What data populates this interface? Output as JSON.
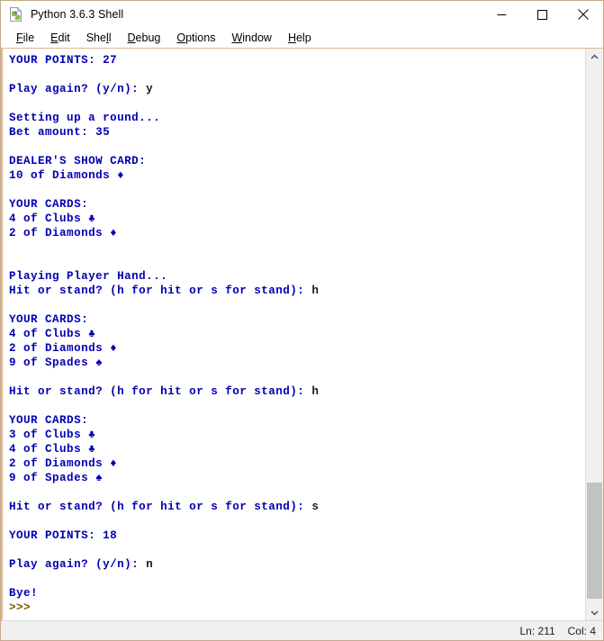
{
  "window": {
    "title": "Python 3.6.3 Shell",
    "icon": "python-file-icon",
    "minimize_label": "Minimize",
    "maximize_label": "Maximize",
    "close_label": "Close"
  },
  "menubar": {
    "items": [
      {
        "label": "File",
        "pre": "",
        "key": "F",
        "post": "ile"
      },
      {
        "label": "Edit",
        "pre": "",
        "key": "E",
        "post": "dit"
      },
      {
        "label": "Shell",
        "pre": "She",
        "key": "l",
        "post": "l"
      },
      {
        "label": "Debug",
        "pre": "",
        "key": "D",
        "post": "ebug"
      },
      {
        "label": "Options",
        "pre": "",
        "key": "O",
        "post": "ptions"
      },
      {
        "label": "Window",
        "pre": "",
        "key": "W",
        "post": "indow"
      },
      {
        "label": "Help",
        "pre": "",
        "key": "H",
        "post": "elp"
      }
    ]
  },
  "colors": {
    "stdout": "#0000b3",
    "stdin": "#1a1a1a",
    "prompt": "#7a5c00",
    "window_border": "#c8a989",
    "background": "#ffffff",
    "chrome": "#f0f0f0"
  },
  "shell": {
    "lines": [
      {
        "segments": [
          {
            "text": "YOUR POINTS: 27",
            "kind": "out"
          }
        ]
      },
      {
        "segments": []
      },
      {
        "segments": [
          {
            "text": "Play again? (y/n): ",
            "kind": "out"
          },
          {
            "text": "y",
            "kind": "in"
          }
        ]
      },
      {
        "segments": []
      },
      {
        "segments": [
          {
            "text": "Setting up a round...",
            "kind": "out"
          }
        ]
      },
      {
        "segments": [
          {
            "text": "Bet amount: 35",
            "kind": "out"
          }
        ]
      },
      {
        "segments": []
      },
      {
        "segments": [
          {
            "text": "DEALER'S SHOW CARD:",
            "kind": "out"
          }
        ]
      },
      {
        "segments": [
          {
            "text": "10 of Diamonds ♦",
            "kind": "out"
          }
        ]
      },
      {
        "segments": []
      },
      {
        "segments": [
          {
            "text": "YOUR CARDS:",
            "kind": "out"
          }
        ]
      },
      {
        "segments": [
          {
            "text": "4 of Clubs ♣",
            "kind": "out"
          }
        ]
      },
      {
        "segments": [
          {
            "text": "2 of Diamonds ♦",
            "kind": "out"
          }
        ]
      },
      {
        "segments": []
      },
      {
        "segments": []
      },
      {
        "segments": [
          {
            "text": "Playing Player Hand...",
            "kind": "out"
          }
        ]
      },
      {
        "segments": [
          {
            "text": "Hit or stand? (h for hit or s for stand): ",
            "kind": "out"
          },
          {
            "text": "h",
            "kind": "in"
          }
        ]
      },
      {
        "segments": []
      },
      {
        "segments": [
          {
            "text": "YOUR CARDS:",
            "kind": "out"
          }
        ]
      },
      {
        "segments": [
          {
            "text": "4 of Clubs ♣",
            "kind": "out"
          }
        ]
      },
      {
        "segments": [
          {
            "text": "2 of Diamonds ♦",
            "kind": "out"
          }
        ]
      },
      {
        "segments": [
          {
            "text": "9 of Spades ♠",
            "kind": "out"
          }
        ]
      },
      {
        "segments": []
      },
      {
        "segments": [
          {
            "text": "Hit or stand? (h for hit or s for stand): ",
            "kind": "out"
          },
          {
            "text": "h",
            "kind": "in"
          }
        ]
      },
      {
        "segments": []
      },
      {
        "segments": [
          {
            "text": "YOUR CARDS:",
            "kind": "out"
          }
        ]
      },
      {
        "segments": [
          {
            "text": "3 of Clubs ♣",
            "kind": "out"
          }
        ]
      },
      {
        "segments": [
          {
            "text": "4 of Clubs ♣",
            "kind": "out"
          }
        ]
      },
      {
        "segments": [
          {
            "text": "2 of Diamonds ♦",
            "kind": "out"
          }
        ]
      },
      {
        "segments": [
          {
            "text": "9 of Spades ♠",
            "kind": "out"
          }
        ]
      },
      {
        "segments": []
      },
      {
        "segments": [
          {
            "text": "Hit or stand? (h for hit or s for stand): ",
            "kind": "out"
          },
          {
            "text": "s",
            "kind": "in"
          }
        ]
      },
      {
        "segments": []
      },
      {
        "segments": [
          {
            "text": "YOUR POINTS: 18",
            "kind": "out"
          }
        ]
      },
      {
        "segments": []
      },
      {
        "segments": [
          {
            "text": "Play again? (y/n): ",
            "kind": "out"
          },
          {
            "text": "n",
            "kind": "in"
          }
        ]
      },
      {
        "segments": []
      },
      {
        "segments": [
          {
            "text": "Bye!",
            "kind": "out"
          }
        ]
      },
      {
        "segments": [
          {
            "text": ">>> ",
            "kind": "prompt"
          }
        ]
      }
    ]
  },
  "scrollbar": {
    "up_arrow": "chevron-up-icon",
    "down_arrow": "chevron-down-icon",
    "thumb_top_pct": 77.5,
    "thumb_height_pct": 21.5
  },
  "statusbar": {
    "line_label": "Ln: 211",
    "col_label": "Col: 4"
  }
}
